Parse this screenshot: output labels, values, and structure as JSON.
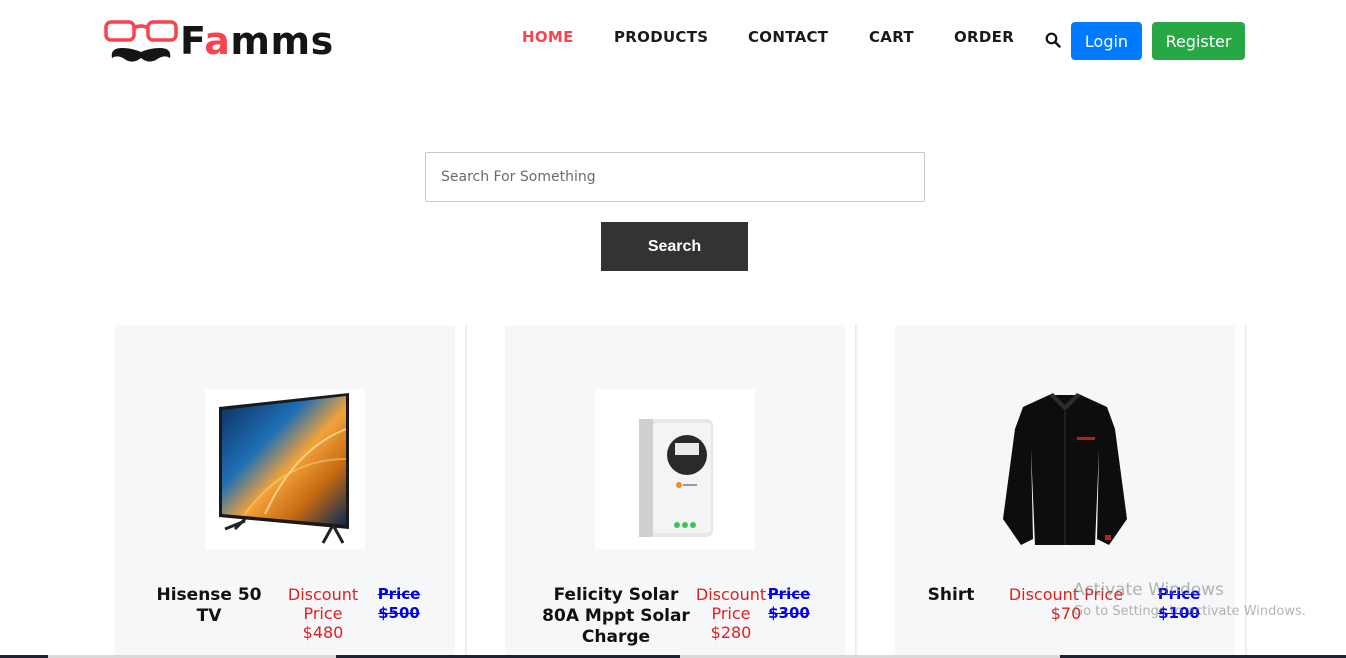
{
  "brand": {
    "logo_prefix": "F",
    "logo_accent": "a",
    "logo_suffix": "mms",
    "accent_color": "#f7444e"
  },
  "nav": {
    "items": [
      {
        "label": "HOME",
        "active": true
      },
      {
        "label": "PRODUCTS",
        "active": false
      },
      {
        "label": "CONTACT",
        "active": false
      },
      {
        "label": "CART",
        "active": false
      },
      {
        "label": "ORDER",
        "active": false
      }
    ],
    "search_icon": "search-icon",
    "login_label": "Login",
    "register_label": "Register"
  },
  "search": {
    "placeholder": "Search For Something",
    "value": "",
    "button_label": "Search"
  },
  "products": [
    {
      "name": "Hisense 50 TV",
      "discount_label": "Discount Price",
      "discount_value": "$480",
      "price_label": "Price",
      "price_value": "$500"
    },
    {
      "name": "Felicity Solar 80A Mppt Solar Charge",
      "discount_label": "Discount Price",
      "discount_value": "$280",
      "price_label": "Price",
      "price_value": "$300"
    },
    {
      "name": "Shirt",
      "discount_label": "Discount Price",
      "discount_value": "$70",
      "price_label": "Price",
      "price_value": "$100"
    }
  ],
  "watermark": {
    "title": "Activate Windows",
    "subtitle": "Go to Settings to activate Windows."
  },
  "colors": {
    "login": "#007bff",
    "register": "#28a745",
    "search_button": "#333333",
    "discount": "#e41e1e",
    "price": "#0000ee"
  }
}
